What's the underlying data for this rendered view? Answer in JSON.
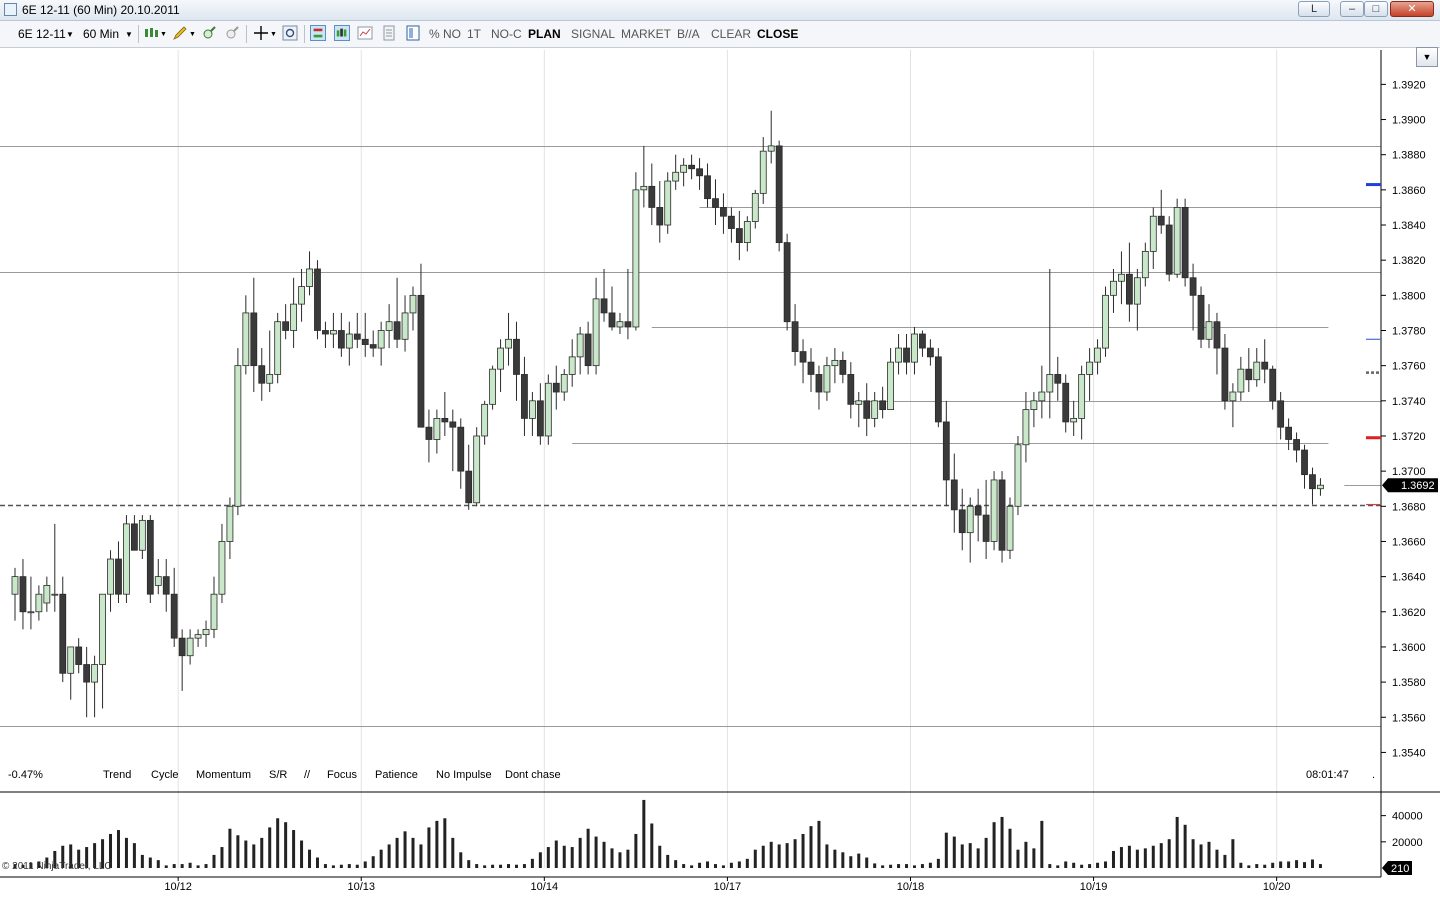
{
  "window": {
    "title": "6E 12-11 (60 Min)  20.10.2011",
    "btn_l": "L",
    "btn_min": "–",
    "btn_max": "□",
    "btn_close": "✕"
  },
  "toolbar": {
    "instrument": "6E 12-11",
    "interval": "60 Min",
    "pct_no": "% NO",
    "one_t": "1T",
    "no_c": "NO-C",
    "plan": "PLAN",
    "signal": "SIGNAL",
    "market": "MARKET",
    "ba": "B//A",
    "clear": "CLEAR",
    "close": "CLOSE"
  },
  "indicators": {
    "change": "-0.47%",
    "trend": "Trend",
    "cycle": "Cycle",
    "momentum": "Momentum",
    "sr": "S/R",
    "sep": "//",
    "focus": "Focus",
    "patience": "Patience",
    "no_impulse": "No Impulse",
    "dont_chase": "Dont chase",
    "time": "08:01:47",
    "dot": "."
  },
  "copyright": "© 2011 NinjaTrader, LLC",
  "colors": {
    "bull_fill": "#c9e8c9",
    "bear_fill": "#3a3a3a",
    "candle_stroke": "#2a2a2a",
    "grid": "#e2e2e2",
    "sr_line": "#9a9a9a",
    "volume": "#222222"
  },
  "chart_data": {
    "type": "candlestick",
    "price_axis": {
      "ylim": [
        1.353,
        1.3935
      ],
      "ticks": [
        1.354,
        1.356,
        1.358,
        1.36,
        1.362,
        1.364,
        1.366,
        1.368,
        1.37,
        1.372,
        1.374,
        1.376,
        1.378,
        1.38,
        1.382,
        1.384,
        1.386,
        1.388,
        1.39,
        1.392
      ],
      "tick_labels": [
        "1.3540",
        "1.3560",
        "1.3580",
        "1.3600",
        "1.3620",
        "1.3640",
        "1.3660",
        "1.3680",
        "1.3700",
        "1.3720",
        "1.3740",
        "1.3760",
        "1.3780",
        "1.3800",
        "1.3820",
        "1.3840",
        "1.3860",
        "1.3880",
        "1.3900",
        "1.3920"
      ],
      "last_price": 1.3692,
      "last_price_label": "1.3692"
    },
    "date_labels": [
      {
        "label": "10/12",
        "bar": 21
      },
      {
        "label": "10/13",
        "bar": 44
      },
      {
        "label": "10/14",
        "bar": 67
      },
      {
        "label": "10/17",
        "bar": 90
      },
      {
        "label": "10/18",
        "bar": 113
      },
      {
        "label": "10/19",
        "bar": 136
      },
      {
        "label": "10/20",
        "bar": 159
      }
    ],
    "horizontal_lines": [
      {
        "price": 1.3885,
        "from_bar": 0,
        "to_bar": 172,
        "style": "solid"
      },
      {
        "price": 1.385,
        "from_bar": 86,
        "to_bar": 172,
        "style": "solid"
      },
      {
        "price": 1.3813,
        "from_bar": 0,
        "to_bar": 172,
        "style": "solid"
      },
      {
        "price": 1.3782,
        "from_bar": 80,
        "to_bar": 165,
        "style": "solid"
      },
      {
        "price": 1.374,
        "from_bar": 105,
        "to_bar": 172,
        "style": "solid"
      },
      {
        "price": 1.3716,
        "from_bar": 70,
        "to_bar": 165,
        "style": "solid"
      },
      {
        "price": 1.3692,
        "from_bar": 167,
        "to_bar": 172,
        "style": "solid"
      },
      {
        "price": 1.3681,
        "from_bar": 0,
        "to_bar": 172,
        "style": "dashed"
      },
      {
        "price": 1.3555,
        "from_bar": 0,
        "to_bar": 172,
        "style": "solid"
      }
    ],
    "axis_markers": [
      {
        "price": 1.3863,
        "color": "#1f3fd8",
        "style": "solid"
      },
      {
        "price": 1.3775,
        "color": "#4a6ad8",
        "style": "thin"
      },
      {
        "price": 1.3756,
        "color": "#666666",
        "style": "dotted"
      },
      {
        "price": 1.3719,
        "color": "#e02020",
        "style": "solid"
      },
      {
        "price": 1.3681,
        "color": "#cc4444",
        "style": "thin"
      }
    ],
    "volume_axis": {
      "ylim": [
        0,
        55000
      ],
      "ticks": [
        20000,
        40000
      ],
      "tick_labels": [
        "20000",
        "40000"
      ],
      "last_volume_label": "210"
    },
    "candles": [
      [
        1.363,
        1.3645,
        1.3615,
        1.364
      ],
      [
        1.364,
        1.365,
        1.361,
        1.362
      ],
      [
        1.362,
        1.364,
        1.361,
        1.362
      ],
      [
        1.362,
        1.3635,
        1.3615,
        1.363
      ],
      [
        1.3625,
        1.364,
        1.362,
        1.3635
      ],
      [
        1.363,
        1.367,
        1.362,
        1.363
      ],
      [
        1.363,
        1.364,
        1.358,
        1.3585
      ],
      [
        1.3585,
        1.36,
        1.357,
        1.36
      ],
      [
        1.36,
        1.3605,
        1.3585,
        1.359
      ],
      [
        1.359,
        1.36,
        1.356,
        1.358
      ],
      [
        1.358,
        1.3595,
        1.356,
        1.359
      ],
      [
        1.359,
        1.363,
        1.3565,
        1.363
      ],
      [
        1.363,
        1.3655,
        1.362,
        1.365
      ],
      [
        1.365,
        1.366,
        1.3625,
        1.363
      ],
      [
        1.363,
        1.3675,
        1.3625,
        1.367
      ],
      [
        1.367,
        1.3675,
        1.3655,
        1.3655
      ],
      [
        1.3655,
        1.3675,
        1.365,
        1.3672
      ],
      [
        1.3672,
        1.3675,
        1.3625,
        1.363
      ],
      [
        1.3635,
        1.365,
        1.363,
        1.364
      ],
      [
        1.364,
        1.365,
        1.362,
        1.363
      ],
      [
        1.363,
        1.3645,
        1.36,
        1.3605
      ],
      [
        1.3605,
        1.361,
        1.3575,
        1.3595
      ],
      [
        1.3595,
        1.361,
        1.359,
        1.3605
      ],
      [
        1.3605,
        1.361,
        1.36,
        1.3607
      ],
      [
        1.3607,
        1.3615,
        1.36,
        1.361
      ],
      [
        1.361,
        1.364,
        1.3605,
        1.363
      ],
      [
        1.363,
        1.367,
        1.3625,
        1.366
      ],
      [
        1.366,
        1.3685,
        1.365,
        1.368
      ],
      [
        1.368,
        1.377,
        1.3675,
        1.376
      ],
      [
        1.376,
        1.38,
        1.3755,
        1.379
      ],
      [
        1.379,
        1.381,
        1.3745,
        1.376
      ],
      [
        1.376,
        1.377,
        1.374,
        1.375
      ],
      [
        1.375,
        1.378,
        1.3745,
        1.3755
      ],
      [
        1.3755,
        1.379,
        1.375,
        1.3785
      ],
      [
        1.3785,
        1.3795,
        1.3775,
        1.378
      ],
      [
        1.378,
        1.381,
        1.377,
        1.3795
      ],
      [
        1.3795,
        1.3815,
        1.3785,
        1.3805
      ],
      [
        1.3805,
        1.3825,
        1.38,
        1.3815
      ],
      [
        1.3815,
        1.382,
        1.3775,
        1.378
      ],
      [
        1.378,
        1.3785,
        1.377,
        1.3778
      ],
      [
        1.3778,
        1.379,
        1.377,
        1.378
      ],
      [
        1.378,
        1.379,
        1.3765,
        1.377
      ],
      [
        1.377,
        1.3785,
        1.376,
        1.3778
      ],
      [
        1.3778,
        1.379,
        1.377,
        1.3775
      ],
      [
        1.3775,
        1.379,
        1.3765,
        1.3772
      ],
      [
        1.3772,
        1.378,
        1.3765,
        1.377
      ],
      [
        1.377,
        1.3785,
        1.376,
        1.378
      ],
      [
        1.378,
        1.3795,
        1.377,
        1.3785
      ],
      [
        1.3785,
        1.381,
        1.377,
        1.3775
      ],
      [
        1.3775,
        1.38,
        1.3768,
        1.379
      ],
      [
        1.379,
        1.3805,
        1.378,
        1.38
      ],
      [
        1.38,
        1.3818,
        1.377,
        1.3725
      ],
      [
        1.3725,
        1.3735,
        1.3705,
        1.3718
      ],
      [
        1.3718,
        1.3735,
        1.371,
        1.373
      ],
      [
        1.373,
        1.3745,
        1.372,
        1.3728
      ],
      [
        1.3728,
        1.3735,
        1.37,
        1.3725
      ],
      [
        1.3725,
        1.373,
        1.369,
        1.37
      ],
      [
        1.37,
        1.3715,
        1.3678,
        1.3682
      ],
      [
        1.3682,
        1.3725,
        1.368,
        1.372
      ],
      [
        1.372,
        1.374,
        1.3715,
        1.3738
      ],
      [
        1.3738,
        1.376,
        1.3735,
        1.3758
      ],
      [
        1.3758,
        1.3775,
        1.3745,
        1.377
      ],
      [
        1.377,
        1.379,
        1.376,
        1.3775
      ],
      [
        1.3775,
        1.3785,
        1.374,
        1.3755
      ],
      [
        1.3755,
        1.3765,
        1.372,
        1.373
      ],
      [
        1.373,
        1.3745,
        1.372,
        1.374
      ],
      [
        1.374,
        1.375,
        1.3715,
        1.372
      ],
      [
        1.372,
        1.3755,
        1.3715,
        1.375
      ],
      [
        1.375,
        1.376,
        1.3735,
        1.3745
      ],
      [
        1.3745,
        1.3758,
        1.374,
        1.3755
      ],
      [
        1.3755,
        1.3775,
        1.3748,
        1.3765
      ],
      [
        1.3765,
        1.3782,
        1.3755,
        1.3778
      ],
      [
        1.3778,
        1.3785,
        1.3755,
        1.376
      ],
      [
        1.376,
        1.381,
        1.3755,
        1.3798
      ],
      [
        1.3798,
        1.3815,
        1.3785,
        1.379
      ],
      [
        1.379,
        1.3805,
        1.378,
        1.3782
      ],
      [
        1.3782,
        1.379,
        1.3778,
        1.3785
      ],
      [
        1.3785,
        1.3815,
        1.3775,
        1.3782
      ],
      [
        1.3782,
        1.387,
        1.378,
        1.386
      ],
      [
        1.386,
        1.3885,
        1.385,
        1.3862
      ],
      [
        1.3862,
        1.3875,
        1.384,
        1.385
      ],
      [
        1.385,
        1.3865,
        1.383,
        1.384
      ],
      [
        1.384,
        1.387,
        1.3835,
        1.3865
      ],
      [
        1.3865,
        1.388,
        1.386,
        1.387
      ],
      [
        1.387,
        1.3878,
        1.3862,
        1.3874
      ],
      [
        1.3874,
        1.388,
        1.3866,
        1.3872
      ],
      [
        1.3872,
        1.3878,
        1.386,
        1.3868
      ],
      [
        1.3868,
        1.3875,
        1.385,
        1.3855
      ],
      [
        1.3855,
        1.3866,
        1.384,
        1.385
      ],
      [
        1.385,
        1.3858,
        1.3835,
        1.3845
      ],
      [
        1.3845,
        1.385,
        1.383,
        1.3838
      ],
      [
        1.3838,
        1.3848,
        1.382,
        1.383
      ],
      [
        1.383,
        1.3845,
        1.3825,
        1.3842
      ],
      [
        1.3842,
        1.386,
        1.3838,
        1.3858
      ],
      [
        1.3858,
        1.389,
        1.3852,
        1.3882
      ],
      [
        1.3882,
        1.3905,
        1.3875,
        1.3885
      ],
      [
        1.3885,
        1.3888,
        1.3825,
        1.383
      ],
      [
        1.383,
        1.3835,
        1.378,
        1.3785
      ],
      [
        1.3785,
        1.3795,
        1.376,
        1.3768
      ],
      [
        1.3768,
        1.3775,
        1.375,
        1.3762
      ],
      [
        1.3762,
        1.377,
        1.3745,
        1.3755
      ],
      [
        1.3755,
        1.376,
        1.3735,
        1.3745
      ],
      [
        1.3745,
        1.3765,
        1.374,
        1.376
      ],
      [
        1.376,
        1.377,
        1.375,
        1.3763
      ],
      [
        1.3763,
        1.3768,
        1.375,
        1.3755
      ],
      [
        1.3755,
        1.3762,
        1.373,
        1.3738
      ],
      [
        1.3738,
        1.3745,
        1.3725,
        1.374
      ],
      [
        1.374,
        1.375,
        1.372,
        1.373
      ],
      [
        1.373,
        1.3745,
        1.3725,
        1.374
      ],
      [
        1.374,
        1.3748,
        1.373,
        1.3735
      ],
      [
        1.3735,
        1.377,
        1.3735,
        1.3762
      ],
      [
        1.3762,
        1.3778,
        1.3755,
        1.377
      ],
      [
        1.377,
        1.3778,
        1.3755,
        1.3762
      ],
      [
        1.3762,
        1.3782,
        1.3755,
        1.3778
      ],
      [
        1.3778,
        1.378,
        1.3765,
        1.377
      ],
      [
        1.377,
        1.3775,
        1.376,
        1.3765
      ],
      [
        1.3765,
        1.377,
        1.3725,
        1.3728
      ],
      [
        1.3728,
        1.374,
        1.368,
        1.3695
      ],
      [
        1.3695,
        1.371,
        1.3665,
        1.3678
      ],
      [
        1.3678,
        1.369,
        1.3655,
        1.3665
      ],
      [
        1.3665,
        1.3685,
        1.3648,
        1.368
      ],
      [
        1.368,
        1.369,
        1.366,
        1.3675
      ],
      [
        1.3675,
        1.3695,
        1.365,
        1.366
      ],
      [
        1.366,
        1.37,
        1.3655,
        1.3695
      ],
      [
        1.3695,
        1.37,
        1.3648,
        1.3655
      ],
      [
        1.3655,
        1.3685,
        1.365,
        1.368
      ],
      [
        1.368,
        1.372,
        1.3675,
        1.3715
      ],
      [
        1.3715,
        1.3745,
        1.3705,
        1.3735
      ],
      [
        1.3735,
        1.3745,
        1.3725,
        1.374
      ],
      [
        1.374,
        1.376,
        1.373,
        1.3745
      ],
      [
        1.3745,
        1.3815,
        1.373,
        1.3755
      ],
      [
        1.3755,
        1.3765,
        1.374,
        1.375
      ],
      [
        1.375,
        1.3755,
        1.3722,
        1.3728
      ],
      [
        1.3728,
        1.374,
        1.372,
        1.373
      ],
      [
        1.373,
        1.376,
        1.3718,
        1.3755
      ],
      [
        1.3755,
        1.377,
        1.374,
        1.3762
      ],
      [
        1.3762,
        1.3775,
        1.3755,
        1.377
      ],
      [
        1.377,
        1.3805,
        1.3765,
        1.38
      ],
      [
        1.38,
        1.3815,
        1.379,
        1.3808
      ],
      [
        1.3808,
        1.3825,
        1.3795,
        1.3812
      ],
      [
        1.3812,
        1.383,
        1.3785,
        1.3795
      ],
      [
        1.3795,
        1.3815,
        1.378,
        1.381
      ],
      [
        1.381,
        1.383,
        1.3805,
        1.3825
      ],
      [
        1.3825,
        1.385,
        1.3815,
        1.3845
      ],
      [
        1.3845,
        1.386,
        1.3835,
        1.384
      ],
      [
        1.384,
        1.3845,
        1.3808,
        1.3812
      ],
      [
        1.3812,
        1.3855,
        1.381,
        1.385
      ],
      [
        1.385,
        1.3855,
        1.3805,
        1.381
      ],
      [
        1.381,
        1.3818,
        1.378,
        1.38
      ],
      [
        1.38,
        1.3805,
        1.377,
        1.3775
      ],
      [
        1.3775,
        1.3795,
        1.377,
        1.3785
      ],
      [
        1.3785,
        1.379,
        1.3755,
        1.377
      ],
      [
        1.377,
        1.3778,
        1.3735,
        1.374
      ],
      [
        1.374,
        1.375,
        1.3725,
        1.3745
      ],
      [
        1.3745,
        1.3765,
        1.374,
        1.3758
      ],
      [
        1.3758,
        1.377,
        1.3745,
        1.3752
      ],
      [
        1.3752,
        1.377,
        1.3748,
        1.3762
      ],
      [
        1.3762,
        1.3775,
        1.375,
        1.3758
      ],
      [
        1.3758,
        1.376,
        1.3735,
        1.374
      ],
      [
        1.374,
        1.3745,
        1.3718,
        1.3725
      ],
      [
        1.3725,
        1.373,
        1.3712,
        1.3718
      ],
      [
        1.3718,
        1.3722,
        1.3705,
        1.3712
      ],
      [
        1.3712,
        1.3715,
        1.369,
        1.3698
      ],
      [
        1.3698,
        1.3702,
        1.3681,
        1.369
      ],
      [
        1.369,
        1.3696,
        1.3686,
        1.3692
      ]
    ],
    "volumes": [
      3000,
      2500,
      4000,
      5000,
      8000,
      13000,
      17000,
      18000,
      14000,
      16000,
      19000,
      22000,
      26000,
      29000,
      23000,
      19000,
      10000,
      8000,
      6000,
      2000,
      3000,
      3000,
      4000,
      2000,
      3000,
      10000,
      16000,
      30000,
      25000,
      21000,
      18000,
      23000,
      31000,
      38000,
      35000,
      29000,
      21000,
      14000,
      8000,
      3000,
      2000,
      2500,
      3000,
      2500,
      5000,
      9000,
      14000,
      18000,
      23000,
      28000,
      23000,
      18000,
      31000,
      36000,
      38000,
      23000,
      12000,
      6000,
      3000,
      2000,
      2500,
      2500,
      3000,
      2500,
      3000,
      7000,
      12000,
      16000,
      21000,
      17000,
      16000,
      23000,
      30000,
      24000,
      20000,
      15000,
      12000,
      14000,
      26000,
      52000,
      34000,
      17000,
      10000,
      6000,
      3000,
      2000,
      4000,
      5000,
      3000,
      2000,
      4000,
      5000,
      7000,
      14000,
      17000,
      20000,
      18000,
      19000,
      22000,
      26000,
      32000,
      36000,
      18000,
      14000,
      12000,
      9000,
      11000,
      8000,
      3500,
      2000,
      2500,
      3000,
      3000,
      2000,
      3000,
      4000,
      7000,
      27000,
      24000,
      18000,
      19000,
      15000,
      23000,
      35000,
      39000,
      30000,
      14000,
      20000,
      15000,
      36000,
      3000,
      2000,
      5000,
      4000,
      2500,
      3000,
      4000,
      5000,
      13000,
      16000,
      17000,
      14000,
      15000,
      17000,
      19000,
      22000,
      39000,
      33000,
      22000,
      18000,
      20000,
      14000,
      10000,
      22000,
      4000,
      2000,
      3000,
      2500,
      4000,
      5000,
      5000,
      6000,
      4500,
      6500,
      3000
    ]
  }
}
